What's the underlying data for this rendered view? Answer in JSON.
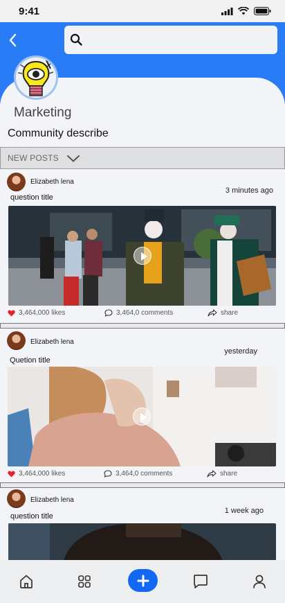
{
  "status_bar": {
    "time": "9:41"
  },
  "header": {
    "back_icon": "chevron-left-icon",
    "search": {
      "placeholder": "",
      "icon": "search-icon"
    },
    "accent_color": "#2a7cf6"
  },
  "community": {
    "name": "Marketing",
    "description": "Community describe"
  },
  "feed_tab": {
    "label": "NEW POSTS",
    "icon": "chevron-down-icon"
  },
  "posts": [
    {
      "author": "Elizabeth lena",
      "time": "3 minutes ago",
      "title": "question title",
      "likes": "3,464,000 likes",
      "comments": "3,464,0 comments",
      "share": "share"
    },
    {
      "author": "Elizabeth lena",
      "time": "yesterday",
      "title": "Quetion title",
      "likes": "3,464,000 likes",
      "comments": "3,464,0 comments",
      "share": "share"
    },
    {
      "author": "Elizabeth lena",
      "time": "1 week ago",
      "title": "question title"
    }
  ],
  "bottom_nav": {
    "items": [
      "home-icon",
      "grid-icon",
      "add-icon",
      "chat-icon",
      "profile-icon"
    ],
    "active_color": "#1268f3"
  }
}
